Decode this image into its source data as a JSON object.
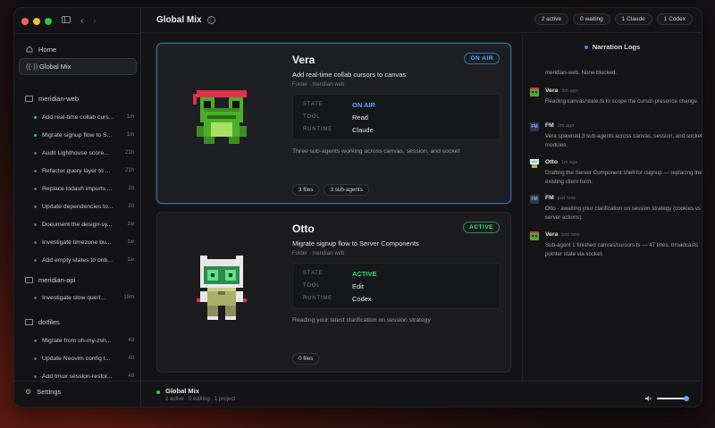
{
  "header": {
    "title": "Global Mix",
    "pills": [
      "2 active",
      "0 waiting",
      "1 Claude",
      "1 Codex"
    ]
  },
  "sidebar": {
    "nav": [
      {
        "label": "Home",
        "icon": "home-icon"
      },
      {
        "label": "Global Mix",
        "icon": "broadcast-icon",
        "active": true
      }
    ],
    "groups": [
      {
        "name": "meridian-web",
        "tasks": [
          {
            "label": "Add real-time collab curs...",
            "age": "1m",
            "on": true
          },
          {
            "label": "Migrate signup flow to S...",
            "age": "1m",
            "on": true
          },
          {
            "label": "Audit Lighthouse score...",
            "age": "21h",
            "on": false
          },
          {
            "label": "Refactor query layer to ...",
            "age": "21h",
            "on": false
          },
          {
            "label": "Replace lodash imports ...",
            "age": "2d",
            "on": false
          },
          {
            "label": "Update dependencies to...",
            "age": "2d",
            "on": false
          },
          {
            "label": "Document the design-sy...",
            "age": "1w",
            "on": false
          },
          {
            "label": "Investigate timezone bu...",
            "age": "1w",
            "on": false
          },
          {
            "label": "Add empty states to onb...",
            "age": "1w",
            "on": false
          }
        ]
      },
      {
        "name": "meridian-api",
        "tasks": [
          {
            "label": "Investigate slow queri...",
            "age": "19m",
            "on": false
          }
        ]
      },
      {
        "name": "dotfiles",
        "tasks": [
          {
            "label": "Migrate from oh-my-zsh...",
            "age": "4d",
            "on": false
          },
          {
            "label": "Update Neovim config t...",
            "age": "4d",
            "on": false
          },
          {
            "label": "Add tmux session-restor...",
            "age": "4d",
            "on": false
          }
        ]
      }
    ],
    "settings_label": "Settings"
  },
  "cards": [
    {
      "name": "Vera",
      "status": "ON AIR",
      "task": "Add real-time collab cursors to canvas",
      "folder": "Folder · meridian-web",
      "info": {
        "state_label": "STATE",
        "state": "ON AIR",
        "tool_label": "TOOL",
        "tool": "Read",
        "runtime_label": "RUNTIME",
        "runtime": "Claude"
      },
      "description": "Three sub-agents working across canvas, session, and socket",
      "tags": [
        "3 files",
        "3 sub-agents"
      ]
    },
    {
      "name": "Otto",
      "status": "ACTIVE",
      "task": "Migrate signup flow to Server Components",
      "folder": "Folder · meridian-web",
      "info": {
        "state_label": "STATE",
        "state": "ACTIVE",
        "tool_label": "TOOL",
        "tool": "Edit",
        "runtime_label": "RUNTIME",
        "runtime": "Codex"
      },
      "description": "Reading your latest clarification on session strategy",
      "tags": [
        "0 files"
      ]
    }
  ],
  "footer": {
    "title": "Global Mix",
    "subtitle": "2 active · 0 waiting · 1 project"
  },
  "logs": {
    "title": "Narration Logs",
    "first_line": "meridian-web. None blocked.",
    "entries": [
      {
        "avatar": "frog",
        "name": "Vera",
        "time": "3m ago",
        "text": "Reading canvas/state.ts to scope the cursor-presence change."
      },
      {
        "avatar": "FM",
        "name": "FM",
        "time": "2m ago",
        "text": "Vera spawned 3 sub-agents across canvas, session, and socket modules."
      },
      {
        "avatar": "bot",
        "name": "Otto",
        "time": "1m ago",
        "text": "Drafting the Server Component shell for /signup — replacing the existing client form."
      },
      {
        "avatar": "FM",
        "name": "FM",
        "time": "just now",
        "text": "Otto · awaiting your clarification on session strategy (cookies vs server actions)."
      },
      {
        "avatar": "frog",
        "name": "Vera",
        "time": "just now",
        "text": "Sub-agent 1 finished canvas/cursors.ts — 47 lines, broadcasts pointer state via socket."
      }
    ]
  }
}
